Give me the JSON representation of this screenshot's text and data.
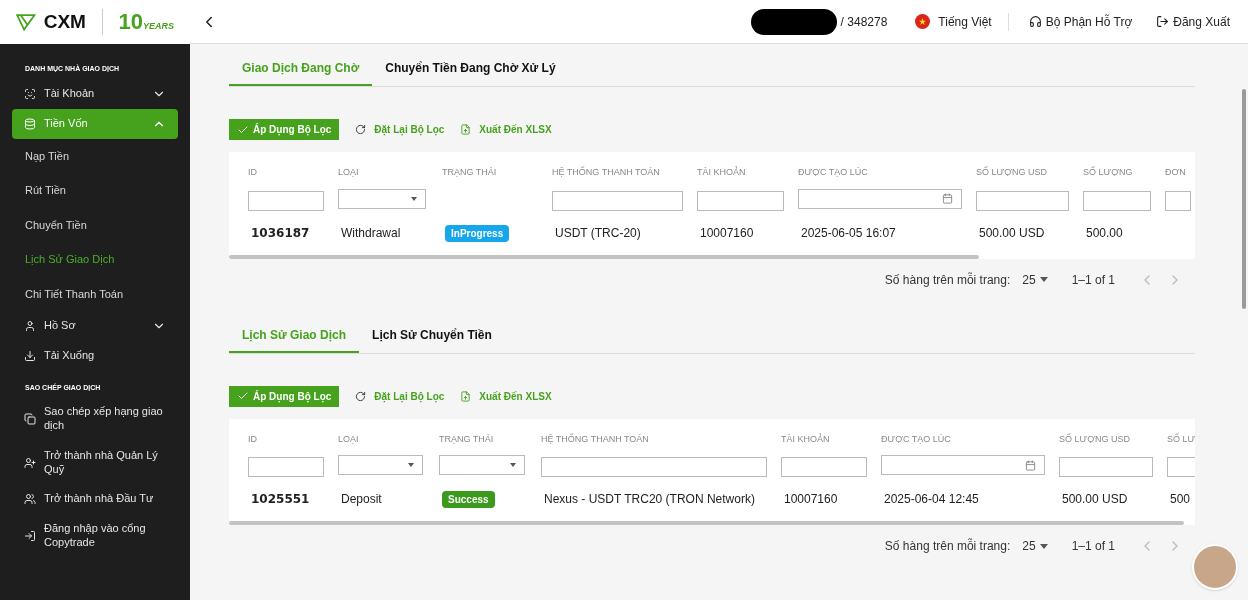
{
  "logo": {
    "brand": "CXM",
    "number": "10",
    "years": "YEARS"
  },
  "sidebar": {
    "sections": [
      {
        "title": "DANH MỤC NHÀ GIAO DỊCH",
        "items": [
          {
            "label": "Tài Khoản",
            "kind": "group",
            "expanded": false,
            "selected": false
          },
          {
            "label": "Tiền Vốn",
            "kind": "database",
            "expanded": true,
            "selected": true,
            "children": [
              {
                "label": "Nạp Tiền",
                "selected": false
              },
              {
                "label": "Rút Tiền",
                "selected": false
              },
              {
                "label": "Chuyển Tiền",
                "selected": false
              },
              {
                "label": "Lịch Sử Giao Dịch",
                "selected": true
              },
              {
                "label": "Chi Tiết Thanh Toán",
                "selected": false
              }
            ]
          },
          {
            "label": "Hồ Sơ",
            "kind": "user",
            "expanded": false,
            "selected": false
          },
          {
            "label": "Tải Xuống",
            "kind": "download",
            "selected": false
          }
        ]
      },
      {
        "title": "SAO CHÉP GIAO DỊCH",
        "items": [
          {
            "label": "Sao chép xếp hạng giao dịch",
            "kind": "copy",
            "selected": false
          },
          {
            "label": "Trở thành nhà Quản Lý Quỹ",
            "kind": "adduser",
            "selected": false
          },
          {
            "label": "Trở thành nhà Đầu Tư",
            "kind": "users",
            "selected": false
          },
          {
            "label": "Đăng nhập vào cổng Copytrade",
            "kind": "login",
            "selected": false
          }
        ]
      }
    ]
  },
  "topbar": {
    "account": "/ 348278",
    "language": "Tiếng Việt",
    "support": "Bộ Phận Hỗ Trợ",
    "logout": "Đăng Xuất"
  },
  "panels": [
    {
      "tabs": [
        {
          "label": "Giao Dịch Đang Chờ",
          "selected": true
        },
        {
          "label": "Chuyển Tiền Đang Chờ Xử Lý",
          "selected": false
        }
      ],
      "actions": [
        "Áp Dụng Bộ Lọc",
        "Đặt Lại Bộ Lọc",
        "Xuất Đến XLSX"
      ],
      "columns": [
        {
          "label": "ID",
          "kind": "text"
        },
        {
          "label": "LOẠI",
          "kind": "select"
        },
        {
          "label": "TRẠNG THÁI",
          "kind": "none"
        },
        {
          "label": "HỆ THỐNG THANH TOÁN",
          "kind": "text"
        },
        {
          "label": "TÀI KHOẢN",
          "kind": "text"
        },
        {
          "label": "ĐƯỢC TẠO LÚC",
          "kind": "date"
        },
        {
          "label": "SỐ LƯỢNG USD",
          "kind": "text"
        },
        {
          "label": "SỐ LƯỢNG",
          "kind": "text"
        },
        {
          "label": "ĐƠN",
          "kind": "text"
        }
      ],
      "rows": [
        {
          "cells": [
            {
              "kind": "id",
              "text": "1036187"
            },
            {
              "kind": "text",
              "text": "Withdrawal"
            },
            {
              "kind": "badge",
              "text": "InProgress",
              "color": "#16a6ec"
            },
            {
              "kind": "text",
              "text": "USDT (TRC-20)"
            },
            {
              "kind": "text",
              "text": "10007160"
            },
            {
              "kind": "text",
              "text": "2025-06-05 16:07"
            },
            {
              "kind": "text",
              "text": "500.00 USD"
            },
            {
              "kind": "text",
              "text": "500.00"
            }
          ]
        }
      ],
      "pagination": {
        "label": "Số hàng trên mỗi trang:",
        "per_page": "25",
        "range": "1–1 of 1"
      }
    },
    {
      "tabs": [
        {
          "label": "Lịch Sử Giao Dịch",
          "selected": true
        },
        {
          "label": "Lịch Sử Chuyển Tiền",
          "selected": false
        }
      ],
      "actions": [
        "Áp Dụng Bộ Lọc",
        "Đặt Lại Bộ Lọc",
        "Xuất Đến XLSX"
      ],
      "columns": [
        {
          "label": "ID",
          "kind": "text"
        },
        {
          "label": "LOẠI",
          "kind": "select"
        },
        {
          "label": "TRẠNG THÁI",
          "kind": "select"
        },
        {
          "label": "HỆ THỐNG THANH TOÁN",
          "kind": "text"
        },
        {
          "label": "TÀI KHOẢN",
          "kind": "text"
        },
        {
          "label": "ĐƯỢC TẠO LÚC",
          "kind": "date"
        },
        {
          "label": "SỐ LƯỢNG USD",
          "kind": "text"
        },
        {
          "label": "SỐ LƯ",
          "kind": "text"
        }
      ],
      "rows": [
        {
          "cells": [
            {
              "kind": "id",
              "text": "1025551"
            },
            {
              "kind": "text",
              "text": "Deposit"
            },
            {
              "kind": "badge",
              "text": "Success",
              "color": "#3a9a1c"
            },
            {
              "kind": "text",
              "text": "Nexus - USDT TRC20 (TRON Network)"
            },
            {
              "kind": "text",
              "text": "10007160"
            },
            {
              "kind": "text",
              "text": "2025-06-04 12:45"
            },
            {
              "kind": "text",
              "text": "500.00 USD"
            },
            {
              "kind": "text",
              "text": "500"
            }
          ]
        }
      ],
      "pagination": {
        "label": "Số hàng trên mỗi trang:",
        "per_page": "25",
        "range": "1–1 of 1"
      }
    }
  ]
}
